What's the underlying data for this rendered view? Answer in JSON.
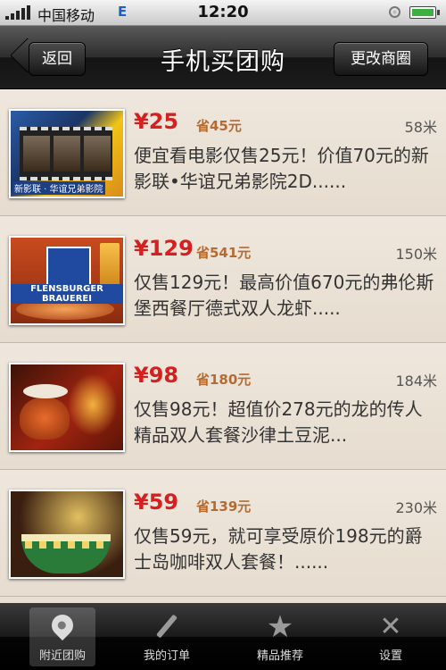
{
  "status_bar": {
    "carrier": "中国移动",
    "network": "E",
    "time": "12:20"
  },
  "nav": {
    "back_label": "返回",
    "title": "手机买团购",
    "right_label": "更改商圈"
  },
  "deals": [
    {
      "price": "¥25",
      "save": "省45元",
      "distance": "58米",
      "desc": "便宜看电影仅售25元！价值70元的新影联•华谊兄弟影院2D......",
      "thumb_label": "新影联 · 华谊兄弟影院"
    },
    {
      "price": "¥129",
      "save": "省541元",
      "distance": "150米",
      "desc": "仅售129元！最高价值670元的弗伦斯堡西餐厅德式双人龙虾.....",
      "thumb_label": "FLENSBURGER BRAUEREI"
    },
    {
      "price": "¥98",
      "save": "省180元",
      "distance": "184米",
      "desc": "仅售98元！超值价278元的龙的传人精品双人套餐沙律土豆泥...",
      "thumb_label": ""
    },
    {
      "price": "¥59",
      "save": "省139元",
      "distance": "230米",
      "desc": "仅售59元，就可享受原价198元的爵士岛咖啡双人套餐！......",
      "thumb_label": ""
    }
  ],
  "tabs": [
    {
      "label": "附近团购",
      "icon": "location-pin-icon",
      "active": true
    },
    {
      "label": "我的订单",
      "icon": "pen-icon",
      "active": false
    },
    {
      "label": "精品推荐",
      "icon": "star-icon",
      "active": false
    },
    {
      "label": "设置",
      "icon": "tools-icon",
      "active": false
    }
  ],
  "colors": {
    "price": "#d71f1f",
    "save": "#b46b31",
    "background": "#e9dfd2"
  }
}
